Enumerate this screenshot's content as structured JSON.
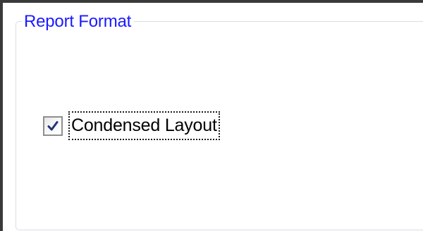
{
  "report_format": {
    "group_title": "Report Format",
    "condensed_layout": {
      "label": "Condensed Layout",
      "checked": true
    }
  },
  "colors": {
    "group_title": "#1a1aff",
    "group_border": "#d5dfe5",
    "checkmark": "#21357a"
  },
  "icons": {
    "checkbox_mark": "checkmark-icon"
  }
}
